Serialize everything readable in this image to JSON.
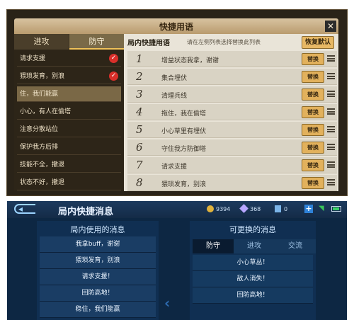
{
  "top": {
    "title": "快捷用语",
    "close_icon": "close-icon",
    "tabs": [
      "进攻",
      "防守"
    ],
    "left_items": [
      {
        "label": "请求支援",
        "checked": true
      },
      {
        "label": "猥琐发育，别浪",
        "checked": true
      },
      {
        "label": "住，我们能赢",
        "checked": false
      },
      {
        "label": "小心，有人在偷塔",
        "checked": false
      },
      {
        "label": "注意分散站位",
        "checked": false
      },
      {
        "label": "保护我方后排",
        "checked": false
      },
      {
        "label": "技能不全，撤退",
        "checked": false
      },
      {
        "label": "状态不好，撤退",
        "checked": false
      }
    ],
    "right_title": "局内快捷用语",
    "right_hint": "请在左侧列表选择替换此列表",
    "restore_label": "恢复默认",
    "swap_label": "替换",
    "rows": [
      {
        "num": "1",
        "text": "增益状态我拿，谢谢"
      },
      {
        "num": "2",
        "text": "集合埋伏"
      },
      {
        "num": "3",
        "text": "清理兵线"
      },
      {
        "num": "4",
        "text": "拖住，我在偷塔"
      },
      {
        "num": "5",
        "text": "小心草里有埋伏"
      },
      {
        "num": "6",
        "text": "守住我方防御塔"
      },
      {
        "num": "7",
        "text": "请求支援"
      },
      {
        "num": "8",
        "text": "猥琐发育，别浪"
      }
    ]
  },
  "bottom": {
    "title": "局内快捷消息",
    "gold": "9394",
    "diamonds": "368",
    "tickets": "0",
    "left_title": "局内使用的消息",
    "left_items": [
      "我拿buff，谢谢",
      "猥琐发育，别浪",
      "请求支援！",
      "回防高地！",
      "稳住，我们能赢"
    ],
    "right_title": "可更换的消息",
    "tabs": [
      "防守",
      "进攻",
      "交流"
    ],
    "right_items": [
      "小心草丛！",
      "敌人消失！",
      "回防高地！"
    ]
  }
}
